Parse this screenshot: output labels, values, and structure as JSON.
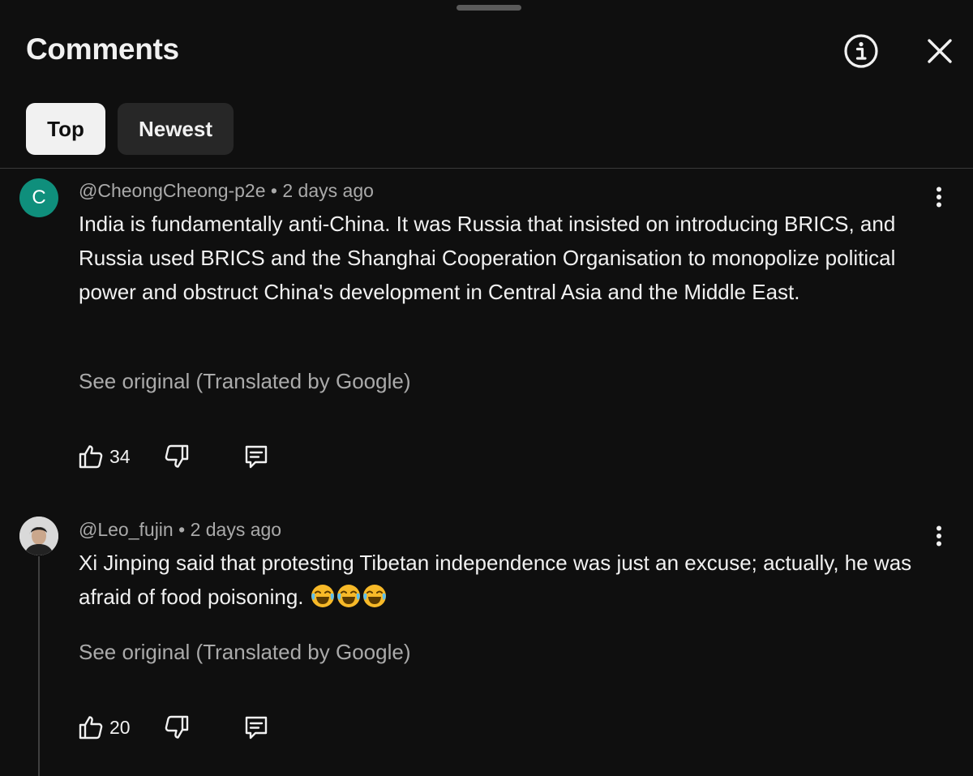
{
  "header": {
    "title": "Comments",
    "info_icon": "info-circle-icon",
    "close_icon": "close-icon"
  },
  "tabs": [
    {
      "label": "Top",
      "active": true
    },
    {
      "label": "Newest",
      "active": false
    }
  ],
  "comments": [
    {
      "avatar_letter": "C",
      "avatar_color": "#0f8f7c",
      "author": "@CheongCheong-p2e",
      "separator": "•",
      "time": "2 days ago",
      "text": "India is fundamentally anti-China. It was Russia that insisted on introducing BRICS, and Russia used BRICS and the Shanghai Cooperation Organisation to monopolize political power and obstruct China's development in Central Asia and the Middle East.",
      "translation_link": "See original (Translated by Google)",
      "likes": "34"
    },
    {
      "avatar_letter": "",
      "avatar_color": "#d8d8d8",
      "author": "@Leo_fujin",
      "separator": "•",
      "time": "2 days ago",
      "text": "Xi Jinping said that protesting Tibetan independence was just an excuse; actually, he was afraid of food poisoning. ",
      "emoji": [
        "face-with-tears-of-joy",
        "face-with-tears-of-joy",
        "face-with-tears-of-joy"
      ],
      "translation_link": "See original (Translated by Google)",
      "likes": "20"
    }
  ],
  "colors": {
    "background": "#0f0f0f",
    "chip_active": "#f1f1f1",
    "chip_inactive": "#272727",
    "secondary_text": "#aaaaaa"
  }
}
